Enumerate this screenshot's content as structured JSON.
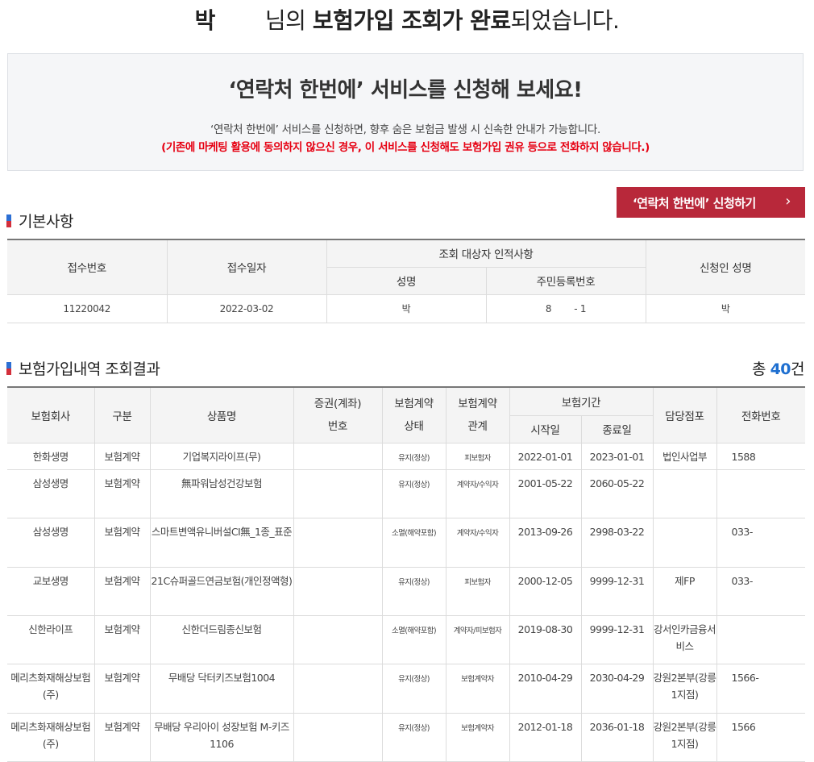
{
  "header": {
    "name_prefix": "박",
    "title_a": "님",
    "title_b": "의 ",
    "title_c": "보험가입 조회가 완료",
    "title_d": "되었습니다."
  },
  "promo": {
    "heading": "‘연락처 한번에’ 서비스를 신청해 보세요!",
    "description": "‘연락처 한번에’ 서비스를 신청하면, 향후 숨은 보험금 발생 시 신속한 안내가 가능합니다.",
    "warning": "(기존에 마케팅 활용에 동의하지 않으신 경우, 이 서비스를 신청해도 보험가입 권유 등으로 전화하지 않습니다.)"
  },
  "apply_button": {
    "label": "‘연락처 한번에’ 신청하기",
    "chevron": "›"
  },
  "basic": {
    "section_title": "기본사항",
    "headers": {
      "receipt_no": "접수번호",
      "receipt_date": "접수일자",
      "target": "조회 대상자 인적사항",
      "name": "성명",
      "rrn": "주민등록번호",
      "applicant": "신청인 성명"
    },
    "row": {
      "receipt_no": "11220042",
      "receipt_date": "2022-03-02",
      "name": "박",
      "rrn": "8        - 1",
      "applicant": "박"
    }
  },
  "results": {
    "section_title": "보험가입내역 조회결과",
    "total_prefix": "총 ",
    "total_count": "40",
    "total_suffix": "건",
    "headers": {
      "company": "보험회사",
      "type": "구분",
      "product": "상품명",
      "policy_no_1": "증권(계좌)",
      "policy_no_2": "번호",
      "status_1": "보험계약",
      "status_2": "상태",
      "relation_1": "보험계약",
      "relation_2": "관계",
      "period": "보험기간",
      "start": "시작일",
      "end": "종료일",
      "branch": "담당점포",
      "phone": "전화번호"
    },
    "rows": [
      {
        "company": "한화생명",
        "type": "보험계약",
        "product": "기업복지라이프(무)",
        "policy_no": "",
        "status": "유지(정상)",
        "relation": "피보험자",
        "start": "2022-01-01",
        "end": "2023-01-01",
        "branch": "법인사업부",
        "phone": "1588"
      },
      {
        "company": "삼성생명",
        "type": "보험계약",
        "product": "無파워남성건강보험",
        "policy_no": "",
        "status": "유지(정상)",
        "relation": "계약자/수익자",
        "start": "2001-05-22",
        "end": "2060-05-22",
        "branch": "",
        "phone": ""
      },
      {
        "company": "삼성생명",
        "type": "보험계약",
        "product": "스마트변액유니버설CI無_1종_표준",
        "policy_no": "",
        "status": "소멸(해약포함)",
        "relation": "계약자/수익자",
        "start": "2013-09-26",
        "end": "2998-03-22",
        "branch": "",
        "phone": "033-"
      },
      {
        "company": "교보생명",
        "type": "보험계약",
        "product": "21C슈퍼골드연금보험(개인정액형)",
        "policy_no": "",
        "status": "유지(정상)",
        "relation": "피보험자",
        "start": "2000-12-05",
        "end": "9999-12-31",
        "branch": "제FP",
        "phone": "033-"
      },
      {
        "company": "신한라이프",
        "type": "보험계약",
        "product": "신한더드림종신보험",
        "policy_no": "",
        "status": "소멸(해약포함)",
        "relation": "계약자/피보험자",
        "start": "2019-08-30",
        "end": "9999-12-31",
        "branch": "강서인카금융서비스",
        "phone": ""
      },
      {
        "company": "메리츠화재해상보험(주)",
        "type": "보험계약",
        "product": "무배당 닥터키즈보험1004",
        "policy_no": "",
        "status": "유지(정상)",
        "relation": "보험계약자",
        "start": "2010-04-29",
        "end": "2030-04-29",
        "branch": "강원2본부(강릉1지점)",
        "phone": "1566-"
      },
      {
        "company": "메리츠화재해상보험(주)",
        "type": "보험계약",
        "product": "무배당 우리아이 성장보험 M-키즈1106",
        "policy_no": "",
        "status": "유지(정상)",
        "relation": "보험계약자",
        "start": "2012-01-18",
        "end": "2036-01-18",
        "branch": "강원2본부(강릉1지점)",
        "phone": "1566"
      }
    ]
  }
}
